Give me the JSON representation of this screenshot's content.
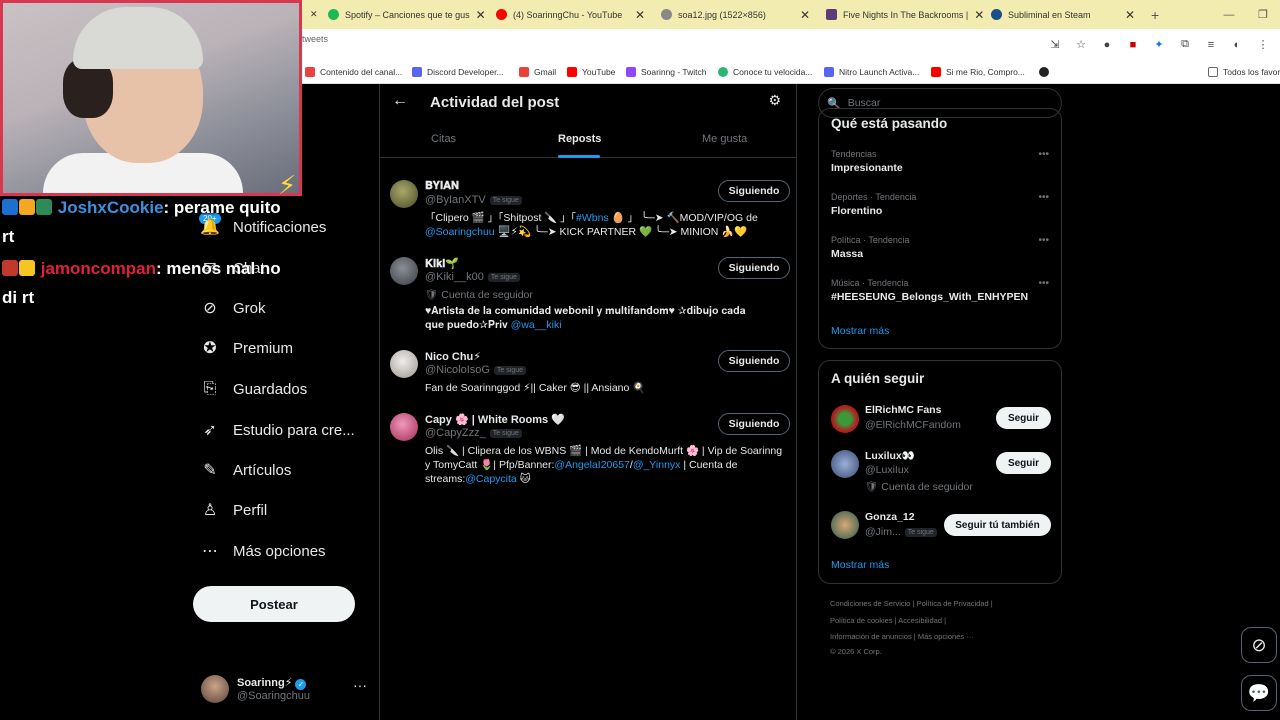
{
  "browser": {
    "tabs": [
      {
        "title": "Spotify – Canciones que te gus",
        "color": "#1db954"
      },
      {
        "title": "(4) SoarinngChu - YouTube",
        "color": "#ff0000"
      },
      {
        "title": "soa12.jpg (1522×856)",
        "color": "#888888"
      },
      {
        "title": "Five Nights In The Backrooms |",
        "color": "#5c3c7a"
      },
      {
        "title": "Subliminal en Steam",
        "color": "#1b4f8a"
      }
    ],
    "url_fragment": "tweets",
    "bookmarks": [
      {
        "label": "Contenido del canal...",
        "color": "#e8433d"
      },
      {
        "label": "Discord Developer...",
        "color": "#5865f2"
      },
      {
        "label": "Gmail",
        "color": "#ea4335"
      },
      {
        "label": "YouTube",
        "color": "#ff0000"
      },
      {
        "label": "Soarinng - Twitch",
        "color": "#9146ff"
      },
      {
        "label": "Conoce tu velocida...",
        "color": "#2bb673"
      },
      {
        "label": "Nitro Launch Activa...",
        "color": "#5865f2"
      },
      {
        "label": "Si me Rio, Compro...",
        "color": "#ff0000"
      },
      {
        "label": "Todos los favoritos",
        "color": "#888888"
      }
    ]
  },
  "stream_chat": [
    {
      "user": "JoshxCookie",
      "message": ": perame quito",
      "cont": "rt"
    },
    {
      "user": "jamoncompan",
      "message": ": menos mal no",
      "cont": "di rt"
    }
  ],
  "nav": {
    "notif_count": "20+",
    "items": [
      {
        "label": "Notificaciones",
        "icon": "bell-icon",
        "glyph": "🔔"
      },
      {
        "label": "Chat",
        "icon": "chat-icon",
        "glyph": "✉"
      },
      {
        "label": "Grok",
        "icon": "grok-icon",
        "glyph": "⊘"
      },
      {
        "label": "Premium",
        "icon": "premium-icon",
        "glyph": "✪"
      },
      {
        "label": "Guardados",
        "icon": "bookmark-icon",
        "glyph": "⎘"
      },
      {
        "label": "Estudio para cre...",
        "icon": "rocket-icon",
        "glyph": "➶"
      },
      {
        "label": "Artículos",
        "icon": "articles-icon",
        "glyph": "✎"
      },
      {
        "label": "Perfil",
        "icon": "profile-icon",
        "glyph": "♙"
      },
      {
        "label": "Más opciones",
        "icon": "more-options-icon",
        "glyph": "⋯"
      }
    ],
    "post_label": "Postear",
    "profile": {
      "name": "Soarinng⚡",
      "handle": "@Soaringchuu"
    }
  },
  "main": {
    "title": "Actividad del post",
    "tabs": [
      "Citas",
      "Reposts",
      "Me gusta"
    ],
    "users": [
      {
        "name": "𝐁𝐘𝐈𝐀𝐍",
        "handle": "@ByIanXTV",
        "follows_you": "Te sigue",
        "button": "Siguiendo",
        "bio": "「Clipero 🎬 」「Shitpost 🔪 」「",
        "bio_link": "#Wbns",
        "bio_rest": " 🥚 」 ╰─➤ 🔨MOD/VIP/OG de",
        "bio2_link": "@Soaringchuu",
        "bio2_rest": " 🖥️⚡💫 ╰─➤ KICK PARTNER 💚 ╰─➤ MINION 🍌💛",
        "avatar_color": "#6b6b3a"
      },
      {
        "name": "𝐊𝐢𝐤𝐢🌱",
        "handle": "@Kiki__k00",
        "follows_you": "Te sigue",
        "button": "Siguiendo",
        "sub": "🛡 Cuenta de seguidor",
        "bio": "♥𝐀𝐫𝐭𝐢𝐬𝐭𝐚 𝐝𝐞 𝐥𝐚 𝐜𝐨𝐦𝐮𝐧𝐢𝐝𝐚𝐝 𝐰𝐞𝐛𝐨𝐧𝐢𝐥 𝐲 𝐦𝐮𝐥𝐭𝐢𝐟𝐚𝐧𝐝𝐨𝐦♥ ✰𝐝𝐢𝐛𝐮𝐣𝐨 𝐜𝐚𝐝𝐚",
        "bio_line2": "𝐪𝐮𝐞 𝐩𝐮𝐞𝐝𝐨✰𝐏𝐫𝐢𝐯 ",
        "bio_link": "@wa__kiki",
        "avatar_color": "#555a60"
      },
      {
        "name": "Nico Chu⚡",
        "handle": "@NicoloIsoG",
        "follows_you": "Te sigue",
        "button": "Siguiendo",
        "bio": "Fan de Soarinnggod ⚡|| Caker 😎 || Ansiano 🍳",
        "avatar_color": "#c9c4c0"
      },
      {
        "name": "Capy 🌸 | White Rooms 🤍",
        "handle": "@CapyZzz_",
        "follows_you": "Te sigue",
        "button": "Siguiendo",
        "bio": "Olis 🔪 | Clipera de los WBNS 🎬 | Mod de KendoMurft 🌸 | Vip de Soarinng",
        "bio_line2": "y TomyCatt 🌷| Pfp/Banner:",
        "bio_link": "@AngelaI20657",
        "bio_sep": "/",
        "bio_link2": "@_Yinnyx",
        "bio_rest": " | Cuenta de",
        "bio_line3": "streams:",
        "bio_link3": "@Capycita",
        "bio_end": " 🐱",
        "avatar_color": "#d4567e"
      }
    ]
  },
  "right": {
    "search_placeholder": "Buscar",
    "trends_title": "Qué está pasando",
    "trends": [
      {
        "meta": "Tendencias",
        "name": "Impresionante"
      },
      {
        "meta": "Deportes · Tendencia",
        "name": "Florentino"
      },
      {
        "meta": "Política · Tendencia",
        "name": "Massa"
      },
      {
        "meta": "Música · Tendencia",
        "name": "#HEESEUNG_Belongs_With_ENHYPEN"
      }
    ],
    "show_more": "Mostrar más",
    "who_title": "A quién seguir",
    "who": [
      {
        "name": "ElRichMC Fans",
        "handle": "@ElRichMCFandom",
        "button": "Seguir",
        "color": "#b02020"
      },
      {
        "name": "Luxilux👀",
        "handle": "@LuxiIux",
        "sub": "🛡 Cuenta de seguidor",
        "button": "Seguir",
        "color": "#4a6aa0"
      },
      {
        "name": "Gonza_12",
        "handle": "@Jim...",
        "follows_you": "Te sigue",
        "button": "Seguir tú también",
        "color": "#3a8a6a"
      }
    ],
    "footer": [
      "Condiciones de Servicio  |  Política de Privacidad  |",
      "Política de cookies  |  Accesibilidad  |",
      "Información de anuncios  |  Más opciones ···",
      "© 2026 X Corp."
    ]
  }
}
